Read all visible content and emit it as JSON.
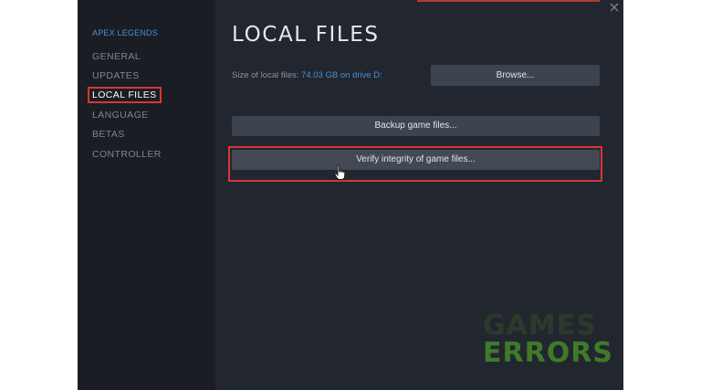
{
  "window": {
    "accent_color": "#b03a3a"
  },
  "sidebar": {
    "game_title": "APEX LEGENDS",
    "items": [
      {
        "label": "GENERAL",
        "active": false
      },
      {
        "label": "UPDATES",
        "active": false
      },
      {
        "label": "LOCAL FILES",
        "active": true
      },
      {
        "label": "LANGUAGE",
        "active": false
      },
      {
        "label": "BETAS",
        "active": false
      },
      {
        "label": "CONTROLLER",
        "active": false
      }
    ]
  },
  "main": {
    "title": "LOCAL FILES",
    "size_prefix": "Size of local files:",
    "size_value": "74.03 GB on drive D:",
    "browse_label": "Browse...",
    "backup_label": "Backup game files...",
    "verify_label": "Verify integrity of game files..."
  },
  "icons": {
    "close": "close-icon",
    "cursor": "hand-cursor-icon"
  },
  "watermark": {
    "line1": "GAMES",
    "line2": "ERRORS"
  },
  "colors": {
    "highlight": "#d73535",
    "link": "#4a8fd6",
    "background": "#22272f",
    "sidebar": "#1a1d23",
    "button": "#3d4450"
  }
}
